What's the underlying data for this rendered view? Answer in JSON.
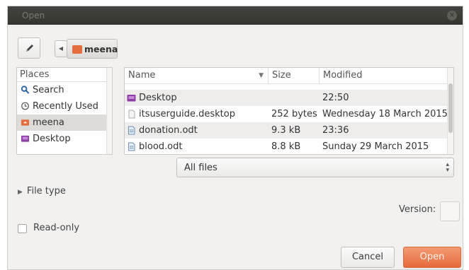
{
  "window": {
    "title": "Open"
  },
  "toolbar": {
    "path_button": "meena"
  },
  "places": {
    "header": "Places",
    "items": [
      {
        "label": "Search",
        "icon": "search-icon",
        "selected": false
      },
      {
        "label": "Recently Used",
        "icon": "clock-icon",
        "selected": false
      },
      {
        "label": "meena",
        "icon": "home-folder-icon",
        "selected": true
      },
      {
        "label": "Desktop",
        "icon": "desktop-folder-icon",
        "selected": false
      }
    ]
  },
  "files": {
    "columns": {
      "name": "Name",
      "size": "Size",
      "modified": "Modified"
    },
    "rows": [
      {
        "name": "Desktop",
        "size": "",
        "modified": "22:50",
        "icon": "desktop-folder-icon"
      },
      {
        "name": "itsuserguide.desktop",
        "size": "252 bytes",
        "modified": "Wednesday 18 March 2015",
        "icon": "file-icon"
      },
      {
        "name": "donation.odt",
        "size": "9.3 kB",
        "modified": "23:36",
        "icon": "document-icon"
      },
      {
        "name": "blood.odt",
        "size": "8.8 kB",
        "modified": "Sunday 29 March 2015",
        "icon": "document-icon"
      }
    ]
  },
  "filter": {
    "value": "All files"
  },
  "file_type": {
    "label": "File type"
  },
  "version": {
    "label": "Version:"
  },
  "read_only": {
    "label": "Read-only",
    "checked": false
  },
  "buttons": {
    "cancel": "Cancel",
    "open": "Open"
  },
  "colors": {
    "accent": "#e9774a",
    "titlebar": "#3c3c37",
    "home_icon": "#e36d3d",
    "folder_icon": "#8e3fa6"
  }
}
